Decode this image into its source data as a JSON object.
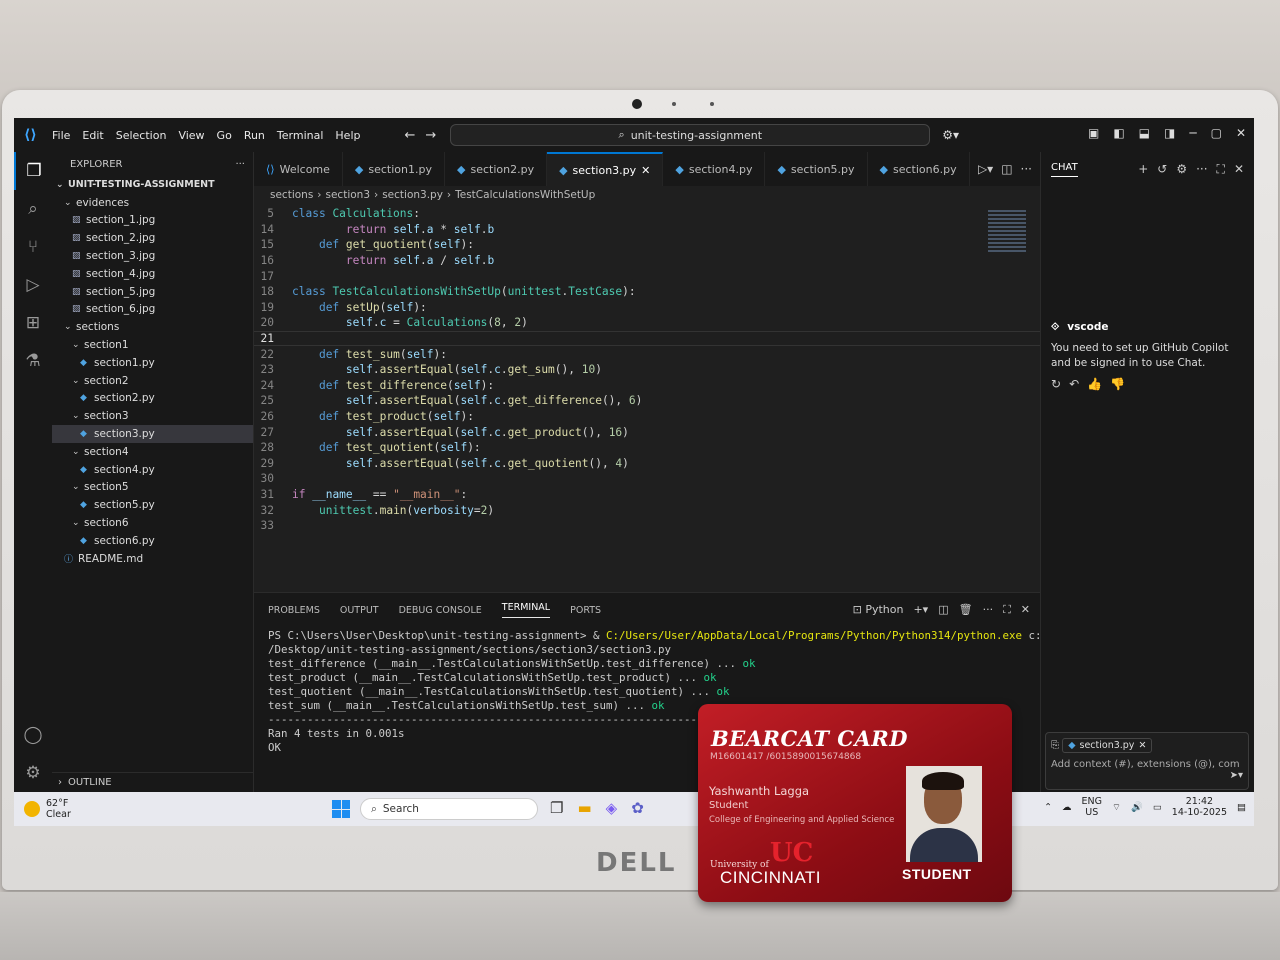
{
  "menu": [
    "File",
    "Edit",
    "Selection",
    "View",
    "Go",
    "Run",
    "Terminal",
    "Help"
  ],
  "command_center": "unit-testing-assignment",
  "explorer": {
    "title": "EXPLORER",
    "root": "UNIT-TESTING-ASSIGNMENT",
    "rows": [
      {
        "label": "evidences",
        "type": "folder",
        "depth": 1
      },
      {
        "label": "section_1.jpg",
        "type": "jpg",
        "depth": 2
      },
      {
        "label": "section_2.jpg",
        "type": "jpg",
        "depth": 2
      },
      {
        "label": "section_3.jpg",
        "type": "jpg",
        "depth": 2
      },
      {
        "label": "section_4.jpg",
        "type": "jpg",
        "depth": 2
      },
      {
        "label": "section_5.jpg",
        "type": "jpg",
        "depth": 2
      },
      {
        "label": "section_6.jpg",
        "type": "jpg",
        "depth": 2
      },
      {
        "label": "sections",
        "type": "folder",
        "depth": 1
      },
      {
        "label": "section1",
        "type": "folder",
        "depth": 2
      },
      {
        "label": "section1.py",
        "type": "py",
        "depth": 3
      },
      {
        "label": "section2",
        "type": "folder",
        "depth": 2
      },
      {
        "label": "section2.py",
        "type": "py",
        "depth": 3
      },
      {
        "label": "section3",
        "type": "folder",
        "depth": 2
      },
      {
        "label": "section3.py",
        "type": "py",
        "depth": 3,
        "selected": true
      },
      {
        "label": "section4",
        "type": "folder",
        "depth": 2
      },
      {
        "label": "section4.py",
        "type": "py",
        "depth": 3
      },
      {
        "label": "section5",
        "type": "folder",
        "depth": 2
      },
      {
        "label": "section5.py",
        "type": "py",
        "depth": 3
      },
      {
        "label": "section6",
        "type": "folder",
        "depth": 2
      },
      {
        "label": "section6.py",
        "type": "py",
        "depth": 3
      },
      {
        "label": "README.md",
        "type": "md",
        "depth": 1
      }
    ],
    "outline": "OUTLINE"
  },
  "tabs": [
    {
      "label": "Welcome",
      "active": false
    },
    {
      "label": "section1.py",
      "active": false
    },
    {
      "label": "section2.py",
      "active": false
    },
    {
      "label": "section3.py",
      "active": true
    },
    {
      "label": "section4.py",
      "active": false
    },
    {
      "label": "section5.py",
      "active": false
    },
    {
      "label": "section6.py",
      "active": false
    }
  ],
  "breadcrumb": [
    "sections",
    "section3",
    "section3.py",
    "TestCalculationsWithSetUp"
  ],
  "code_lines": [
    {
      "n": "5",
      "html": "<span class='kw'>class</span> <span class='cls'>Calculations</span><span class='plain'>:</span>"
    },
    {
      "n": "14",
      "html": "        <span class='ctl'>return</span> <span class='sf'>self</span><span class='plain'>.</span><span class='sf'>a</span> <span class='plain'>*</span> <span class='sf'>self</span><span class='plain'>.</span><span class='sf'>b</span>"
    },
    {
      "n": "15",
      "html": "    <span class='kw'>def</span> <span class='fn'>get_quotient</span><span class='plain'>(</span><span class='sf'>self</span><span class='plain'>):</span>"
    },
    {
      "n": "16",
      "html": "        <span class='ctl'>return</span> <span class='sf'>self</span><span class='plain'>.</span><span class='sf'>a</span> <span class='plain'>/</span> <span class='sf'>self</span><span class='plain'>.</span><span class='sf'>b</span>"
    },
    {
      "n": "17",
      "html": ""
    },
    {
      "n": "18",
      "html": "<span class='kw'>class</span> <span class='cls'>TestCalculationsWithSetUp</span><span class='plain'>(</span><span class='cls'>unittest</span><span class='plain'>.</span><span class='cls'>TestCase</span><span class='plain'>):</span>"
    },
    {
      "n": "19",
      "html": "    <span class='kw'>def</span> <span class='fn'>setUp</span><span class='plain'>(</span><span class='sf'>self</span><span class='plain'>):</span>"
    },
    {
      "n": "20",
      "html": "        <span class='sf'>self</span><span class='plain'>.</span><span class='sf'>c</span> <span class='plain'>=</span> <span class='cls'>Calculations</span><span class='plain'>(</span><span class='num-l'>8</span><span class='plain'>, </span><span class='num-l'>2</span><span class='plain'>)</span>"
    },
    {
      "n": "21",
      "html": "",
      "cur": true
    },
    {
      "n": "22",
      "html": "    <span class='kw'>def</span> <span class='fn'>test_sum</span><span class='plain'>(</span><span class='sf'>self</span><span class='plain'>):</span>"
    },
    {
      "n": "23",
      "html": "        <span class='sf'>self</span><span class='plain'>.</span><span class='fn'>assertEqual</span><span class='plain'>(</span><span class='sf'>self</span><span class='plain'>.</span><span class='sf'>c</span><span class='plain'>.</span><span class='fn'>get_sum</span><span class='plain'>(), </span><span class='num-l'>10</span><span class='plain'>)</span>"
    },
    {
      "n": "24",
      "html": "    <span class='kw'>def</span> <span class='fn'>test_difference</span><span class='plain'>(</span><span class='sf'>self</span><span class='plain'>):</span>"
    },
    {
      "n": "25",
      "html": "        <span class='sf'>self</span><span class='plain'>.</span><span class='fn'>assertEqual</span><span class='plain'>(</span><span class='sf'>self</span><span class='plain'>.</span><span class='sf'>c</span><span class='plain'>.</span><span class='fn'>get_difference</span><span class='plain'>(), </span><span class='num-l'>6</span><span class='plain'>)</span>"
    },
    {
      "n": "26",
      "html": "    <span class='kw'>def</span> <span class='fn'>test_product</span><span class='plain'>(</span><span class='sf'>self</span><span class='plain'>):</span>"
    },
    {
      "n": "27",
      "html": "        <span class='sf'>self</span><span class='plain'>.</span><span class='fn'>assertEqual</span><span class='plain'>(</span><span class='sf'>self</span><span class='plain'>.</span><span class='sf'>c</span><span class='plain'>.</span><span class='fn'>get_product</span><span class='plain'>(), </span><span class='num-l'>16</span><span class='plain'>)</span>"
    },
    {
      "n": "28",
      "html": "    <span class='kw'>def</span> <span class='fn'>test_quotient</span><span class='plain'>(</span><span class='sf'>self</span><span class='plain'>):</span>"
    },
    {
      "n": "29",
      "html": "        <span class='sf'>self</span><span class='plain'>.</span><span class='fn'>assertEqual</span><span class='plain'>(</span><span class='sf'>self</span><span class='plain'>.</span><span class='sf'>c</span><span class='plain'>.</span><span class='fn'>get_quotient</span><span class='plain'>(), </span><span class='num-l'>4</span><span class='plain'>)</span>"
    },
    {
      "n": "30",
      "html": ""
    },
    {
      "n": "31",
      "html": "<span class='ctl'>if</span> <span class='sf'>__name__</span> <span class='plain'>==</span> <span class='str'>\"__main__\"</span><span class='plain'>:</span>"
    },
    {
      "n": "32",
      "html": "    <span class='cls'>unittest</span><span class='plain'>.</span><span class='fn'>main</span><span class='plain'>(</span><span class='sf'>verbosity</span><span class='plain'>=</span><span class='num-l'>2</span><span class='plain'>)</span>"
    },
    {
      "n": "33",
      "html": ""
    }
  ],
  "panel": {
    "tabs": [
      "PROBLEMS",
      "OUTPUT",
      "DEBUG CONSOLE",
      "TERMINAL",
      "PORTS"
    ],
    "active_tab": "TERMINAL",
    "shell": "Python",
    "terminal": [
      {
        "t": "PS C:\\Users\\User\\Desktop\\unit-testing-assignment> & ",
        "y": "C:/Users/User/AppData/Local/Programs/Python/Python314/python.exe",
        "r": " c:/Users/User"
      },
      {
        "t": "/Desktop/unit-testing-assignment/sections/section3/section3.py"
      },
      {
        "t": "test_difference (__main__.TestCalculationsWithSetUp.test_difference) ... ",
        "ok": "ok"
      },
      {
        "t": "test_product (__main__.TestCalculationsWithSetUp.test_product) ... ",
        "ok": "ok"
      },
      {
        "t": "test_quotient (__main__.TestCalculationsWithSetUp.test_quotient) ... ",
        "ok": "ok"
      },
      {
        "t": "test_sum (__main__.TestCalculationsWithSetUp.test_sum) ... ",
        "ok": "ok"
      },
      {
        "t": ""
      },
      {
        "t": "----------------------------------------------------------------------"
      },
      {
        "t": "Ran 4 tests in 0.001s"
      },
      {
        "t": ""
      },
      {
        "t": "OK"
      }
    ]
  },
  "chat": {
    "title": "CHAT",
    "sender": "vscode",
    "message": "You need to set up GitHub Copilot and be signed in to use Chat.",
    "context_chip": "section3.py",
    "input_placeholder": "Add context (#), extensions (@), com"
  },
  "taskbar": {
    "temp": "62°F",
    "weather": "Clear",
    "search": "Search",
    "lang1": "ENG",
    "lang2": "US",
    "time": "21:42",
    "date": "14-10-2025"
  },
  "card": {
    "title": "BEARCAT CARD",
    "id": "M16601417 /6015890015674868",
    "name": "Yashwanth Lagga",
    "role": "Student",
    "college": "College of Engineering and Applied Science",
    "uni_line1": "University of",
    "uni_line2": "CINCINNATI",
    "badge": "STUDENT"
  },
  "laptop_brand": "DELL",
  "colors": {
    "accent": "#0078d4",
    "card": "#b0141c",
    "ok": "#23d18b",
    "path": "#e5e510"
  }
}
